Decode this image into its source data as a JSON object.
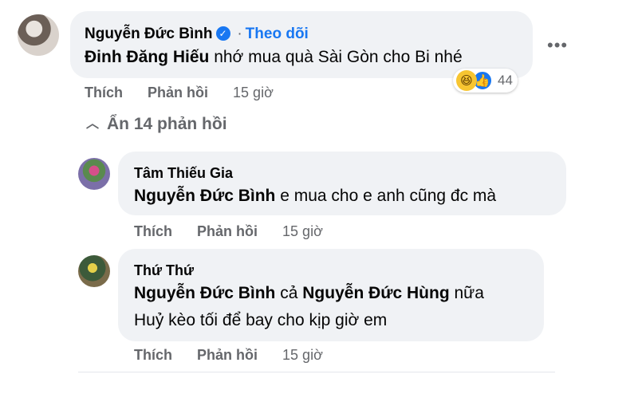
{
  "comment": {
    "author": "Nguyễn Đức Bình",
    "verified": true,
    "follow_label": "Theo dõi",
    "separator": "·",
    "mention": "Đinh Đăng Hiếu",
    "text": "nhớ mua quà Sài Gòn cho Bi nhé",
    "reactions": [
      "haha",
      "like"
    ],
    "reaction_count": "44",
    "like_label": "Thích",
    "reply_label": "Phản hồi",
    "time": "15 giờ",
    "more_icon": "ellipsis-icon"
  },
  "toggle_replies": "Ẩn 14 phản hồi",
  "replies": [
    {
      "author": "Tâm Thiếu Gia",
      "mention": "Nguyễn Đức Bình",
      "text": "e mua cho e anh cũng đc mà",
      "like_label": "Thích",
      "reply_label": "Phản hồi",
      "time": "15 giờ"
    },
    {
      "author": "Thứ Thứ",
      "mention": "Nguyễn Đức Bình",
      "connector": "cả",
      "mention2": "Nguyễn Đức Hùng",
      "suffix": "nữa",
      "text_line2": "Huỷ kèo tối để bay cho kịp giờ em",
      "like_label": "Thích",
      "reply_label": "Phản hồi",
      "time": "15 giờ"
    }
  ],
  "colors": {
    "bubble": "#f0f2f5",
    "link": "#1877f2",
    "muted": "#65676b"
  }
}
